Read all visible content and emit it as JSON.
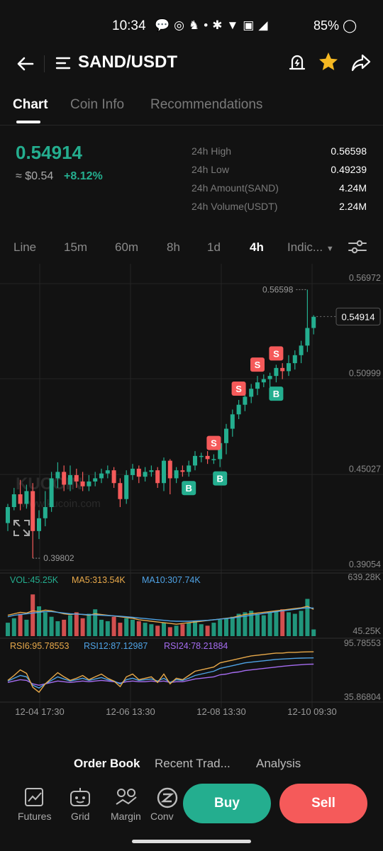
{
  "status_bar": {
    "time": "10:34",
    "battery": "85%",
    "icons": [
      "chat-icon",
      "messenger-icon",
      "notify-icon",
      "dot-icon",
      "bluetooth-icon",
      "wifi-icon",
      "volte-icon",
      "signal-icon",
      "battery-icon"
    ]
  },
  "header": {
    "title": "SAND/USDT"
  },
  "tabs": [
    {
      "label": "Chart",
      "active": true
    },
    {
      "label": "Coin Info"
    },
    {
      "label": "Recommendations"
    }
  ],
  "ticker": {
    "price": "0.54914",
    "fiat": "≈ $0.54",
    "change": "+8.12%",
    "stats": [
      {
        "label": "24h High",
        "value": "0.56598"
      },
      {
        "label": "24h Low",
        "value": "0.49239"
      },
      {
        "label": "24h Amount(SAND)",
        "value": "4.24M"
      },
      {
        "label": "24h Volume(USDT)",
        "value": "2.24M"
      }
    ]
  },
  "intervals": [
    {
      "label": "Line"
    },
    {
      "label": "15m"
    },
    {
      "label": "60m"
    },
    {
      "label": "8h"
    },
    {
      "label": "1d"
    },
    {
      "label": "4h",
      "active": true
    },
    {
      "label": "Indic..."
    }
  ],
  "chart_data": {
    "type": "candlestick",
    "price_axis": {
      "ticks": [
        "0.56972",
        "0.50999",
        "0.45027",
        "0.39054"
      ],
      "ylim": [
        0.39054,
        0.56972
      ]
    },
    "current_price_label": "0.54914",
    "high_label": "0.56598",
    "low_label": "0.39802",
    "watermark": "KUCOIN",
    "watermark_url": "www.kucoin.com",
    "x_ticks": [
      "12-04 17:30",
      "12-06 13:30",
      "12-08 13:30",
      "12-10 09:30"
    ],
    "candles": [
      [
        0.42,
        0.43,
        0.415,
        0.432
      ],
      [
        0.43,
        0.438,
        0.428,
        0.442
      ],
      [
        0.438,
        0.432,
        0.428,
        0.447
      ],
      [
        0.432,
        0.44,
        0.429,
        0.444
      ],
      [
        0.44,
        0.415,
        0.398,
        0.445
      ],
      [
        0.415,
        0.423,
        0.41,
        0.428
      ],
      [
        0.423,
        0.43,
        0.418,
        0.44
      ],
      [
        0.43,
        0.448,
        0.427,
        0.452
      ],
      [
        0.448,
        0.452,
        0.442,
        0.458
      ],
      [
        0.452,
        0.444,
        0.44,
        0.456
      ],
      [
        0.444,
        0.45,
        0.44,
        0.456
      ],
      [
        0.45,
        0.446,
        0.442,
        0.454
      ],
      [
        0.446,
        0.443,
        0.44,
        0.452
      ],
      [
        0.443,
        0.446,
        0.44,
        0.45
      ],
      [
        0.446,
        0.448,
        0.443,
        0.452
      ],
      [
        0.448,
        0.451,
        0.445,
        0.454
      ],
      [
        0.451,
        0.453,
        0.448,
        0.456
      ],
      [
        0.453,
        0.445,
        0.442,
        0.455
      ],
      [
        0.445,
        0.435,
        0.43,
        0.448
      ],
      [
        0.435,
        0.45,
        0.432,
        0.453
      ],
      [
        0.45,
        0.454,
        0.447,
        0.457
      ],
      [
        0.454,
        0.449,
        0.445,
        0.456
      ],
      [
        0.449,
        0.452,
        0.446,
        0.455
      ],
      [
        0.452,
        0.453,
        0.449,
        0.456
      ],
      [
        0.453,
        0.445,
        0.442,
        0.455
      ],
      [
        0.445,
        0.459,
        0.44,
        0.461
      ],
      [
        0.459,
        0.448,
        0.438,
        0.46
      ],
      [
        0.448,
        0.453,
        0.445,
        0.455
      ],
      [
        0.453,
        0.452,
        0.449,
        0.456
      ],
      [
        0.452,
        0.456,
        0.449,
        0.459
      ],
      [
        0.456,
        0.462,
        0.453,
        0.465
      ],
      [
        0.462,
        0.462,
        0.458,
        0.464
      ],
      [
        0.462,
        0.46,
        0.457,
        0.465
      ],
      [
        0.46,
        0.46,
        0.457,
        0.463
      ],
      [
        0.46,
        0.47,
        0.455,
        0.472
      ],
      [
        0.47,
        0.479,
        0.463,
        0.482
      ],
      [
        0.479,
        0.488,
        0.474,
        0.491
      ],
      [
        0.488,
        0.494,
        0.485,
        0.497
      ],
      [
        0.494,
        0.499,
        0.49,
        0.501
      ],
      [
        0.499,
        0.504,
        0.495,
        0.507
      ],
      [
        0.504,
        0.508,
        0.5,
        0.512
      ],
      [
        0.508,
        0.51,
        0.505,
        0.513
      ],
      [
        0.51,
        0.512,
        0.498,
        0.514
      ],
      [
        0.512,
        0.517,
        0.508,
        0.519
      ],
      [
        0.517,
        0.515,
        0.51,
        0.52
      ],
      [
        0.515,
        0.52,
        0.512,
        0.525
      ],
      [
        0.52,
        0.525,
        0.516,
        0.528
      ],
      [
        0.525,
        0.531,
        0.52,
        0.534
      ],
      [
        0.531,
        0.542,
        0.527,
        0.566
      ],
      [
        0.542,
        0.549,
        0.538,
        0.55
      ]
    ],
    "markers": [
      {
        "type": "B",
        "index": 29
      },
      {
        "type": "B",
        "index": 34
      },
      {
        "type": "S",
        "index": 33
      },
      {
        "type": "S",
        "index": 37
      },
      {
        "type": "S",
        "index": 40
      },
      {
        "type": "S",
        "index": 43
      },
      {
        "type": "B",
        "index": 43
      }
    ],
    "volume": {
      "label": "VOL:45.25K",
      "ma5_label": "MA5:313.54K",
      "ma10_label": "MA10:307.74K",
      "max_label": "639.28K",
      "last_label": "45.25K",
      "values": [
        90,
        120,
        150,
        110,
        280,
        200,
        160,
        130,
        100,
        110,
        140,
        160,
        120,
        150,
        180,
        110,
        100,
        130,
        90,
        120,
        110,
        100,
        90,
        80,
        70,
        90,
        60,
        70,
        80,
        90,
        100,
        80,
        70,
        90,
        110,
        120,
        130,
        150,
        160,
        170,
        150,
        140,
        160,
        170,
        180,
        160,
        150,
        170,
        250,
        45
      ],
      "ma5": [
        140,
        150,
        160,
        155,
        170,
        165,
        175,
        170,
        160,
        150,
        145,
        150,
        145,
        140,
        150,
        145,
        140,
        135,
        130,
        125,
        120,
        110,
        105,
        100,
        95,
        90,
        85,
        80,
        85,
        90,
        95,
        100,
        105,
        110,
        115,
        120,
        125,
        135,
        145,
        150,
        155,
        160,
        165,
        170,
        175,
        180,
        185,
        190,
        200,
        180
      ],
      "ma10": [
        130,
        140,
        145,
        150,
        155,
        160,
        165,
        165,
        160,
        155,
        150,
        148,
        146,
        144,
        142,
        140,
        138,
        136,
        134,
        130,
        126,
        122,
        118,
        114,
        110,
        106,
        102,
        100,
        100,
        100,
        102,
        104,
        106,
        110,
        114,
        118,
        122,
        128,
        134,
        140,
        146,
        152,
        158,
        164,
        170,
        175,
        180,
        185,
        190,
        188
      ]
    },
    "rsi": {
      "rsi6_label": "RSI6:95.78553",
      "rsi12_label": "RSI12:87.12987",
      "rsi24_label": "RSI24:78.21884",
      "max_label": "95.78553",
      "min_label": "35.86804",
      "rsi6": [
        55,
        62,
        70,
        65,
        45,
        38,
        50,
        58,
        66,
        60,
        55,
        58,
        62,
        56,
        60,
        64,
        58,
        54,
        46,
        60,
        64,
        56,
        58,
        60,
        52,
        64,
        50,
        58,
        56,
        62,
        68,
        70,
        72,
        74,
        80,
        82,
        84,
        86,
        88,
        90,
        91,
        92,
        93,
        94,
        94,
        95,
        95,
        95.5,
        95.7,
        95.8
      ],
      "rsi12": [
        54,
        58,
        62,
        60,
        48,
        44,
        50,
        55,
        60,
        57,
        54,
        56,
        58,
        55,
        57,
        59,
        56,
        54,
        50,
        56,
        58,
        55,
        56,
        57,
        54,
        58,
        52,
        56,
        55,
        58,
        62,
        64,
        66,
        68,
        72,
        74,
        76,
        78,
        80,
        81,
        82,
        83,
        84,
        85,
        85.5,
        86,
        86.5,
        86.8,
        87,
        87.1
      ],
      "rsi24": [
        52,
        54,
        56,
        55,
        50,
        48,
        50,
        52,
        54,
        53,
        52,
        53,
        54,
        53,
        54,
        55,
        54,
        53,
        51,
        53,
        54,
        53,
        53,
        54,
        53,
        54,
        52,
        53,
        53,
        55,
        57,
        58,
        59,
        60,
        63,
        64,
        66,
        67,
        69,
        70,
        71,
        72,
        73,
        74,
        75,
        76,
        76.8,
        77.4,
        78,
        78.2
      ]
    }
  },
  "bottom_tabs": [
    {
      "label": "Order Book",
      "active": true
    },
    {
      "label": "Recent Trad..."
    },
    {
      "label": "Analysis"
    }
  ],
  "bottom_nav": [
    {
      "label": "Futures",
      "icon": "futures-icon"
    },
    {
      "label": "Grid",
      "icon": "grid-bot-icon"
    },
    {
      "label": "Margin",
      "icon": "margin-icon"
    },
    {
      "label": "Conv",
      "icon": "convert-icon"
    }
  ],
  "actions": {
    "buy": "Buy",
    "sell": "Sell"
  },
  "colors": {
    "up": "#24ae8f",
    "down": "#f55a5a",
    "ma5": "#e8a94a",
    "ma10": "#4fa3e6",
    "rsi24": "#a56cf0",
    "bg": "#121212"
  }
}
